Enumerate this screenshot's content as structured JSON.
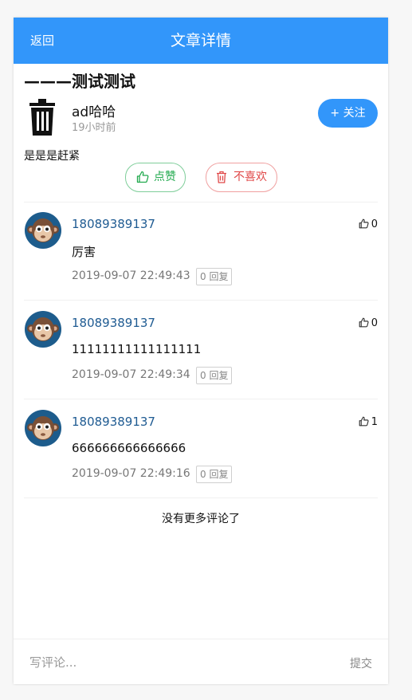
{
  "header": {
    "back_label": "返回",
    "title": "文章详情"
  },
  "article": {
    "title": "———测试测试",
    "author": "ad哈哈",
    "time": "19小时前",
    "follow_label": "+ 关注",
    "body": "是是是赶紧",
    "like_label": "点赞",
    "dislike_label": "不喜欢"
  },
  "comments": [
    {
      "user": "18089389137",
      "text": "厉害",
      "date": "2019-09-07 22:49:43",
      "reply": "0 回复",
      "likes": "0"
    },
    {
      "user": "18089389137",
      "text": "11111111111111111",
      "date": "2019-09-07 22:49:34",
      "reply": "0 回复",
      "likes": "0"
    },
    {
      "user": "18089389137",
      "text": "666666666666666",
      "date": "2019-09-07 22:49:16",
      "reply": "0 回复",
      "likes": "1"
    }
  ],
  "no_more_text": "没有更多评论了",
  "footer": {
    "placeholder": "写评论...",
    "submit_label": "提交"
  },
  "colors": {
    "accent": "#3296fa",
    "like_green": "#20a94d",
    "dislike_red": "#e04848",
    "username_blue": "#1f5b92"
  },
  "icons": [
    "trash-icon",
    "thumbs-up-icon",
    "trash-icon",
    "monkey-avatar"
  ]
}
